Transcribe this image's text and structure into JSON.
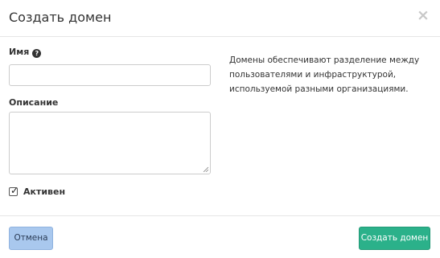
{
  "dialog": {
    "title": "Создать домен",
    "close_symbol": "×"
  },
  "form": {
    "name": {
      "label": "Имя",
      "help_icon": "question-circle-icon",
      "value": ""
    },
    "description": {
      "label": "Описание",
      "value": ""
    },
    "enabled": {
      "label": "Активен",
      "checked": true
    }
  },
  "help_text": "Домены обеспечивают разделение между пользователями и инфраструктурой, используемой разными организациями.",
  "footer": {
    "cancel_label": "Отмена",
    "submit_label": "Создать домен"
  },
  "colors": {
    "cancel_bg": "#a9c8ee",
    "primary_bg": "#2bb18a"
  }
}
